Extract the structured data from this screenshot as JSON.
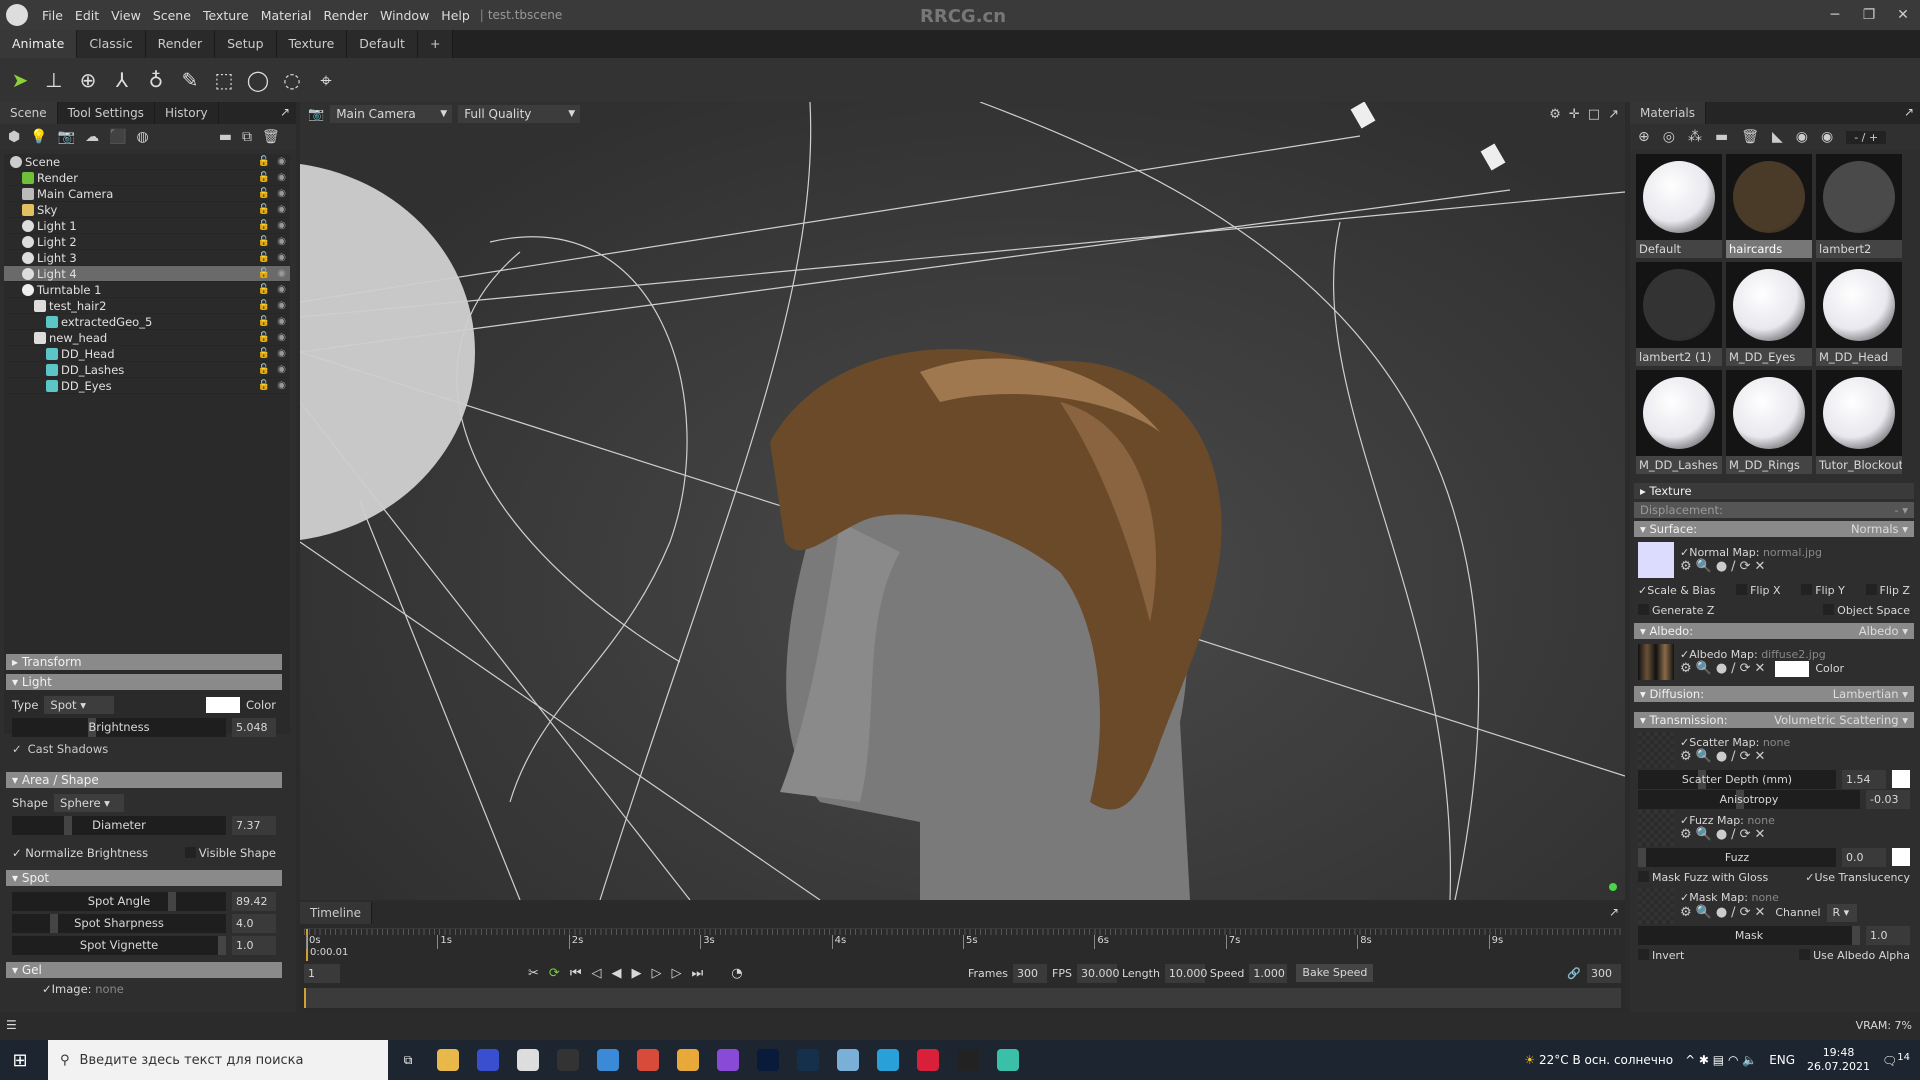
{
  "titlebar": {
    "menus": [
      "File",
      "Edit",
      "View",
      "Scene",
      "Texture",
      "Material",
      "Render",
      "Window",
      "Help"
    ],
    "file": "test.tbscene",
    "watermark": "RRCG.cn"
  },
  "workspace_tabs": [
    "Animate",
    "Classic",
    "Render",
    "Setup",
    "Texture",
    "Default",
    "+"
  ],
  "tools": [
    "select-arrow",
    "translate",
    "rotate",
    "scale",
    "pivot",
    "paint",
    "rect-select",
    "circle-select",
    "lasso-select",
    "polygon-select"
  ],
  "left": {
    "tabs": [
      "Scene",
      "Tool Settings",
      "History"
    ],
    "tree": [
      {
        "label": "Scene",
        "depth": 0,
        "icon": "scene",
        "color": "#cccccc"
      },
      {
        "label": "Render",
        "depth": 1,
        "icon": "gear",
        "color": "#6fbf3a"
      },
      {
        "label": "Main Camera",
        "depth": 1,
        "icon": "camera",
        "color": "#bbbbbb"
      },
      {
        "label": "Sky",
        "depth": 1,
        "icon": "sky",
        "color": "#e0c060"
      },
      {
        "label": "Light 1",
        "depth": 1,
        "icon": "bulb",
        "color": "#dddddd"
      },
      {
        "label": "Light 2",
        "depth": 1,
        "icon": "bulb",
        "color": "#dddddd"
      },
      {
        "label": "Light 3",
        "depth": 1,
        "icon": "bulb",
        "color": "#dddddd"
      },
      {
        "label": "Light 4",
        "depth": 1,
        "icon": "bulb",
        "color": "#dddddd",
        "selected": true
      },
      {
        "label": "Turntable 1",
        "depth": 1,
        "icon": "turntable",
        "color": "#eeeeee"
      },
      {
        "label": "test_hair2",
        "depth": 2,
        "icon": "group",
        "color": "#dddddd"
      },
      {
        "label": "extractedGeo_5",
        "depth": 3,
        "icon": "mesh",
        "color": "#5cc6c6"
      },
      {
        "label": "new_head",
        "depth": 2,
        "icon": "group",
        "color": "#dddddd"
      },
      {
        "label": "DD_Head",
        "depth": 3,
        "icon": "mesh",
        "color": "#5cc6c6"
      },
      {
        "label": "DD_Lashes",
        "depth": 3,
        "icon": "mesh",
        "color": "#5cc6c6"
      },
      {
        "label": "DD_Eyes",
        "depth": 3,
        "icon": "mesh",
        "color": "#5cc6c6"
      }
    ],
    "props": {
      "transform": "Transform",
      "light": "Light",
      "type_label": "Type",
      "type_value": "Spot",
      "color_label": "Color",
      "brightness_label": "Brightness",
      "brightness": "5.048",
      "cast_shadows": "Cast Shadows",
      "area": "Area / Shape",
      "shape_label": "Shape",
      "shape_value": "Sphere",
      "diameter_label": "Diameter",
      "diameter": "7.37",
      "normalize": "Normalize Brightness",
      "visible_shape": "Visible Shape",
      "spot": "Spot",
      "spot_angle_label": "Spot Angle",
      "spot_angle": "89.42",
      "sharp_label": "Spot Sharpness",
      "sharp": "4.0",
      "vig_label": "Spot Vignette",
      "vig": "1.0",
      "gel": "Gel",
      "image_label": "Image:",
      "image_value": "none"
    }
  },
  "viewport": {
    "camera": "Main Camera",
    "quality": "Full Quality"
  },
  "timeline": {
    "title": "Timeline",
    "ticks": [
      "0s",
      "1s",
      "2s",
      "3s",
      "4s",
      "5s",
      "6s",
      "7s",
      "8s",
      "9s"
    ],
    "current_time": "0:00.01",
    "frame": "1",
    "frames_label": "Frames",
    "frames": "300",
    "fps_label": "FPS",
    "fps": "30.000",
    "length_label": "Length",
    "length": "10.000",
    "speed_label": "Speed",
    "speed": "1.000",
    "bake": "Bake Speed",
    "end_frame": "300"
  },
  "materials": {
    "title": "Materials",
    "page": "- / +",
    "items": [
      {
        "name": "Default",
        "ball": "#e8e8ee"
      },
      {
        "name": "haircards",
        "ball": "#4a3a28",
        "selected": true
      },
      {
        "name": "lambert2",
        "ball": "#4a4a4a"
      },
      {
        "name": "lambert2 (1)",
        "ball": "#333333"
      },
      {
        "name": "M_DD_Eyes",
        "ball": "#e8e8ee"
      },
      {
        "name": "M_DD_Head",
        "ball": "#e8e8ee"
      },
      {
        "name": "M_DD_Lashes",
        "ball": "#e8e8ee"
      },
      {
        "name": "M_DD_Rings",
        "ball": "#e8e8ee"
      },
      {
        "name": "Tutor_Blockout",
        "ball": "#e8e8ee"
      }
    ]
  },
  "editor": {
    "texture": "Texture",
    "displacement": "Displacement:",
    "displacement_value": "-",
    "surface": "Surface:",
    "surface_value": "Normals",
    "normal_map": "Normal Map:",
    "normal_file": "normal.jpg",
    "normal_swatch": "#dcdcff",
    "scale_bias": "Scale & Bias",
    "flipx": "Flip X",
    "flipy": "Flip Y",
    "flipz": "Flip Z",
    "genz": "Generate Z",
    "objspace": "Object Space",
    "albedo": "Albedo:",
    "albedo_value": "Albedo",
    "albedo_map": "Albedo Map:",
    "albedo_file": "diffuse2.jpg",
    "color": "Color",
    "diffusion": "Diffusion:",
    "diffusion_value": "Lambertian",
    "transmission": "Transmission:",
    "transmission_value": "Volumetric Scattering",
    "scatter_map": "Scatter Map:",
    "none": "none",
    "scatter_depth": "Scatter Depth (mm)",
    "scatter_depth_value": "1.54",
    "anisotropy": "Anisotropy",
    "anisotropy_value": "-0.03",
    "fuzz_map": "Fuzz Map:",
    "fuzz": "Fuzz",
    "fuzz_value": "0.0",
    "mask_fuzz": "Mask Fuzz with Gloss",
    "use_transl": "Use Translucency",
    "mask_map": "Mask Map:",
    "channel": "Channel",
    "channel_value": "R",
    "mask": "Mask",
    "mask_value": "1.0",
    "invert": "Invert",
    "use_albedo_alpha": "Use Albedo Alpha"
  },
  "status": {
    "vram": "VRAM: 7%"
  },
  "taskbar": {
    "search_placeholder": "Введите здесь текст для поиска",
    "apps": [
      {
        "name": "file-explorer",
        "color": "#e8b84a"
      },
      {
        "name": "app-blue",
        "color": "#3a4fd0"
      },
      {
        "name": "app-search",
        "color": "#dddddd"
      },
      {
        "name": "app-obs",
        "color": "#333333"
      },
      {
        "name": "app-box",
        "color": "#3a8ad8"
      },
      {
        "name": "chrome",
        "color": "#d84a3a"
      },
      {
        "name": "app-yandex",
        "color": "#e8a83a"
      },
      {
        "name": "app-purple",
        "color": "#8a4ad8"
      },
      {
        "name": "photoshop",
        "color": "#0a1a3a"
      },
      {
        "name": "app-dark",
        "color": "#15304a"
      },
      {
        "name": "app-doc",
        "color": "#7ab0d8"
      },
      {
        "name": "edge",
        "color": "#2aa0d8"
      },
      {
        "name": "app-red",
        "color": "#d8203a"
      },
      {
        "name": "unreal",
        "color": "#222222"
      },
      {
        "name": "app-m",
        "color": "#3ac0a8"
      }
    ],
    "weather": "22°C  В осн. солнечно",
    "lang": "ENG",
    "time": "19:48",
    "date": "26.07.2021",
    "notif": "14"
  }
}
